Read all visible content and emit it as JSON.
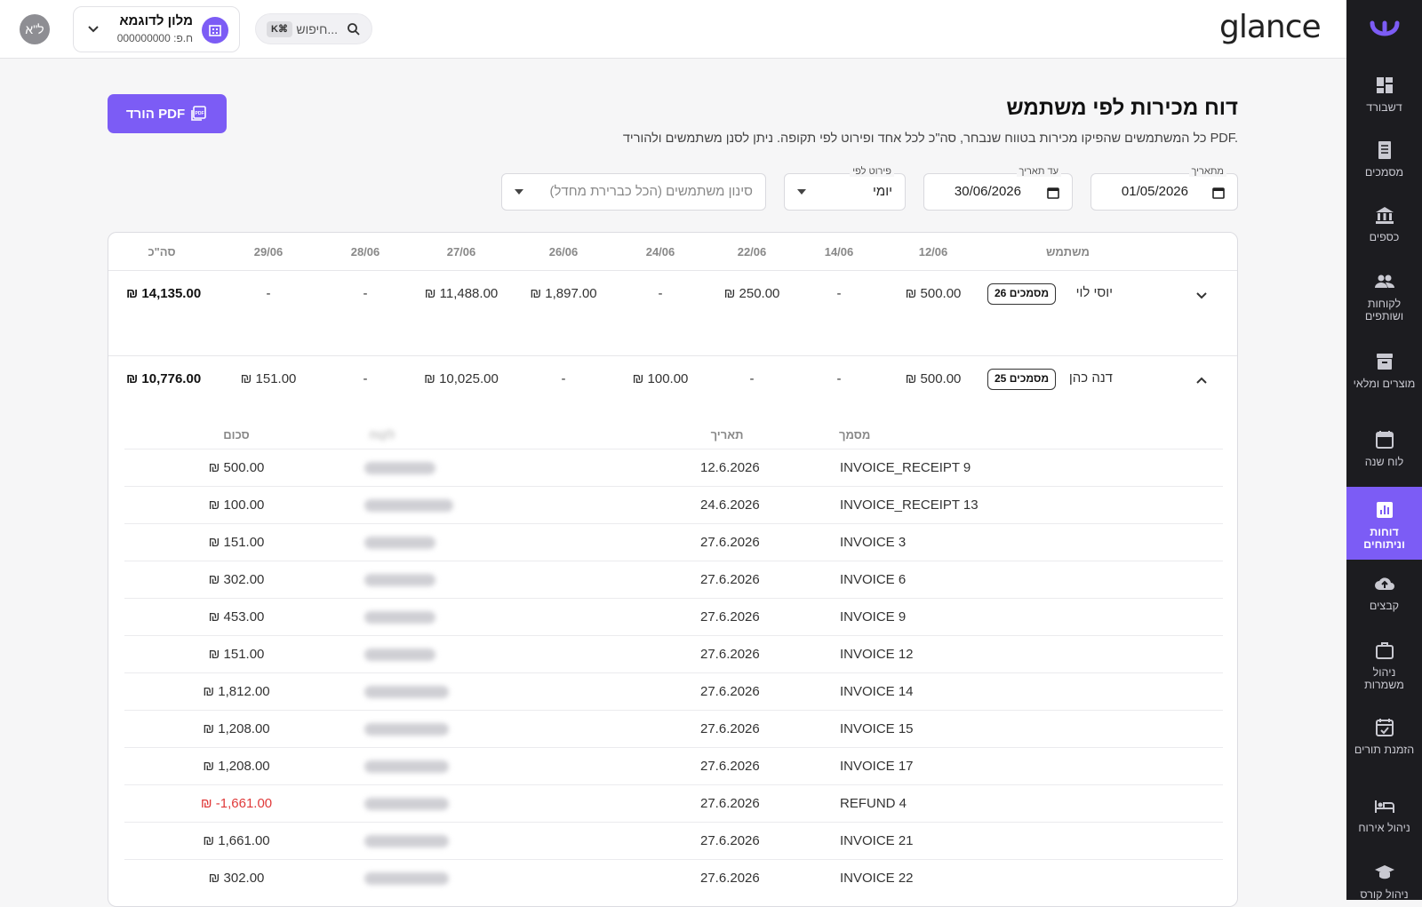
{
  "topbar": {
    "avatar_initials": "ל\"א",
    "org_name": "מלון לדוגמא",
    "org_tax_id": "ח.פ: 000000000",
    "search_placeholder": "חיפוש...",
    "search_shortcut": "K⌘",
    "logo": "glance"
  },
  "sidebar": {
    "items": [
      {
        "label": "דשבורד",
        "icon": "dashboard-icon"
      },
      {
        "label": "מסמכים",
        "icon": "receipt-icon"
      },
      {
        "label": "כספים",
        "icon": "bank-icon"
      },
      {
        "label": "לקוחות ושותפים",
        "icon": "people-icon"
      },
      {
        "label": "מוצרים ומלאי",
        "icon": "archive-icon"
      },
      {
        "label": "לוח שנה",
        "icon": "calendar-icon"
      },
      {
        "label": "דוחות וניתוחים",
        "icon": "chart-icon",
        "active": true
      },
      {
        "label": "קבצים",
        "icon": "cloud-upload-icon"
      },
      {
        "label": "ניהול משמרות",
        "icon": "briefcase-icon"
      },
      {
        "label": "הזמנת תורים",
        "icon": "calendar-check-icon"
      },
      {
        "label": "ניהול אירוח",
        "icon": "bed-icon"
      },
      {
        "label": "ניהול קורס",
        "icon": "graduation-icon"
      }
    ]
  },
  "page": {
    "title": "דוח מכירות לפי משתמש",
    "subtitle": "כל המשתמשים שהפיקו מכירות בטווח שנבחר, סה\"כ לכל אחד ופירוט לפי תקופה. ניתן לסנן משתמשים ולהוריד PDF.",
    "pdf_button": "הורד PDF"
  },
  "filters": {
    "from_label": "מתאריך",
    "from_value": "01/05/2026",
    "to_label": "עד תאריך",
    "to_value": "30/06/2026",
    "breakdown_label": "פירוט לפי",
    "breakdown_value": "יומי",
    "users_placeholder": "סינון משתמשים (הכל כברירת מחדל)"
  },
  "table": {
    "columns": [
      "משתמש",
      "12/06",
      "14/06",
      "22/06",
      "24/06",
      "26/06",
      "27/06",
      "28/06",
      "29/06",
      "סה\"כ"
    ],
    "rows": [
      {
        "user": "יוסי לוי",
        "docs": "26 מסמכים",
        "values": [
          "₪ 500.00",
          "-",
          "₪ 250.00",
          "-",
          "₪ 1,897.00",
          "₪ 11,488.00",
          "-",
          "-",
          "₪ 14,135.00"
        ],
        "expanded": false
      },
      {
        "user": "דנה כהן",
        "docs": "25 מסמכים",
        "values": [
          "₪ 500.00",
          "-",
          "-",
          "₪ 100.00",
          "-",
          "₪ 10,025.00",
          "-",
          "₪ 151.00",
          "₪ 10,776.00"
        ],
        "expanded": true
      }
    ]
  },
  "details": {
    "columns": [
      "מסמך",
      "תאריך",
      "לקוח",
      "סכום"
    ],
    "rows": [
      {
        "doc": "INVOICE_RECEIPT 9",
        "date": "12.6.2026",
        "amount": "₪ 500.00"
      },
      {
        "doc": "INVOICE_RECEIPT 13",
        "date": "24.6.2026",
        "amount": "₪ 100.00"
      },
      {
        "doc": "INVOICE 3",
        "date": "27.6.2026",
        "amount": "₪ 151.00"
      },
      {
        "doc": "INVOICE 6",
        "date": "27.6.2026",
        "amount": "₪ 302.00"
      },
      {
        "doc": "INVOICE 9",
        "date": "27.6.2026",
        "amount": "₪ 453.00"
      },
      {
        "doc": "INVOICE 12",
        "date": "27.6.2026",
        "amount": "₪ 151.00"
      },
      {
        "doc": "INVOICE 14",
        "date": "27.6.2026",
        "amount": "₪ 1,812.00"
      },
      {
        "doc": "INVOICE 15",
        "date": "27.6.2026",
        "amount": "₪ 1,208.00"
      },
      {
        "doc": "INVOICE 17",
        "date": "27.6.2026",
        "amount": "₪ 1,208.00"
      },
      {
        "doc": "REFUND 4",
        "date": "27.6.2026",
        "amount": "₪ -1,661.00",
        "negative": true
      },
      {
        "doc": "INVOICE 21",
        "date": "27.6.2026",
        "amount": "₪ 1,661.00"
      },
      {
        "doc": "INVOICE 22",
        "date": "27.6.2026",
        "amount": "₪ 302.00"
      }
    ]
  },
  "colors": {
    "accent": "#7c5cf5",
    "sidebar_bg": "#1c1c20",
    "negative": "#e03a3a"
  }
}
